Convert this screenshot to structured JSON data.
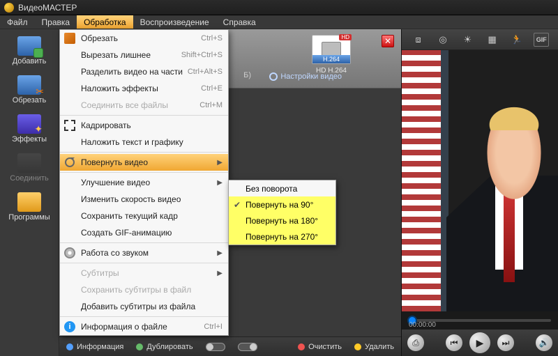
{
  "title": "ВидеоМАСТЕР",
  "menubar": {
    "items": [
      "Файл",
      "Правка",
      "Обработка",
      "Воспроизведение",
      "Справка"
    ],
    "active_index": 2
  },
  "sidebar": [
    {
      "label": "Добавить",
      "icon": "film-add-icon",
      "disabled": false
    },
    {
      "label": "Обрезать",
      "icon": "film-cut-icon",
      "disabled": false
    },
    {
      "label": "Эффекты",
      "icon": "film-fx-icon",
      "disabled": false
    },
    {
      "label": "Соединить",
      "icon": "film-join-icon",
      "disabled": true
    },
    {
      "label": "Программы",
      "icon": "film-programs-icon",
      "disabled": false
    }
  ],
  "center_header": {
    "format_size_suffix": "Б)",
    "settings_link": "Настройки видео",
    "thumb": {
      "badge": "HD",
      "codec_bar": "H.264",
      "caption": "HD H.264"
    }
  },
  "dropdown": {
    "items": [
      {
        "label": "Обрезать",
        "shortcut": "Ctrl+S",
        "icon": "crop-icon"
      },
      {
        "label": "Вырезать лишнее",
        "shortcut": "Shift+Ctrl+S"
      },
      {
        "label": "Разделить видео на части",
        "shortcut": "Ctrl+Alt+S"
      },
      {
        "label": "Наложить эффекты",
        "shortcut": "Ctrl+E"
      },
      {
        "label": "Соединить все файлы",
        "shortcut": "Ctrl+M",
        "disabled": true
      },
      {
        "sep": true
      },
      {
        "label": "Кадрировать",
        "icon": "frame-icon"
      },
      {
        "label": "Наложить текст и графику"
      },
      {
        "sep": true
      },
      {
        "label": "Повернуть видео",
        "icon": "rotate-icon",
        "submenu": true,
        "highlighted": true
      },
      {
        "sep": true
      },
      {
        "label": "Улучшение видео",
        "submenu": true
      },
      {
        "label": "Изменить скорость видео"
      },
      {
        "label": "Сохранить текущий кадр"
      },
      {
        "label": "Создать GIF-анимацию"
      },
      {
        "sep": true
      },
      {
        "label": "Работа со звуком",
        "icon": "cd-icon",
        "submenu": true
      },
      {
        "sep": true
      },
      {
        "label": "Субтитры",
        "disabled": true,
        "submenu": true
      },
      {
        "label": "Сохранить субтитры в файл",
        "disabled": true
      },
      {
        "label": "Добавить субтитры из файла"
      },
      {
        "sep": true
      },
      {
        "label": "Информация о файле",
        "shortcut": "Ctrl+I",
        "icon": "info-icon"
      }
    ]
  },
  "submenu": {
    "items": [
      {
        "label": "Без поворота",
        "checked": false
      },
      {
        "label": "Повернуть на 90°",
        "checked": true
      },
      {
        "label": "Повернуть на 180°",
        "checked": false
      },
      {
        "label": "Повернуть на 270°",
        "checked": false
      }
    ]
  },
  "right_toolbar": {
    "icons": [
      "crop-frame-icon",
      "target-icon",
      "brightness-icon",
      "film-tool-icon",
      "runner-icon",
      "gif-label"
    ]
  },
  "scrub": {
    "timecode": "00:00:00"
  },
  "status_bar": {
    "info": "Информация",
    "duplicate": "Дублировать",
    "clear": "Очистить",
    "delete": "Удалить"
  },
  "player": {
    "snapshot": "snapshot-icon",
    "prev": "prev-icon",
    "play": "play-icon",
    "next": "next-icon",
    "volume": "volume-icon"
  }
}
